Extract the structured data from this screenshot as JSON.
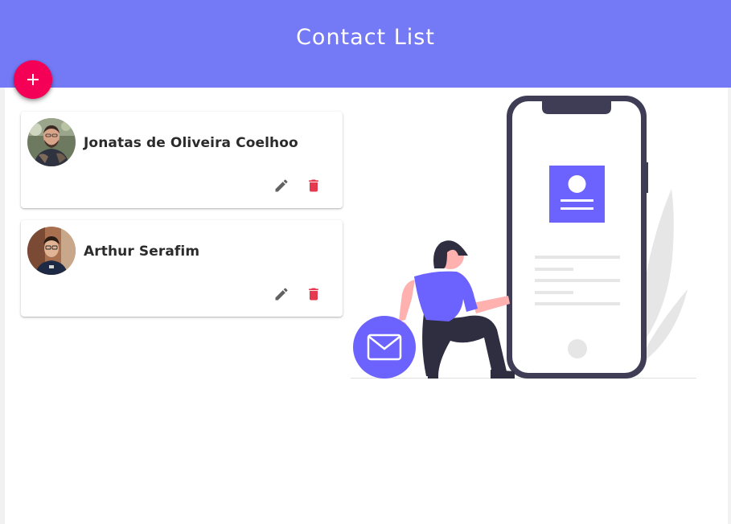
{
  "header": {
    "title": "Contact List"
  },
  "fab": {
    "icon": "plus-icon"
  },
  "contacts": [
    {
      "name": "Jonatas de Oliveira Coelhoo",
      "edit_icon": "pencil-icon",
      "delete_icon": "trash-icon"
    },
    {
      "name": "Arthur Serafim",
      "edit_icon": "pencil-icon",
      "delete_icon": "trash-icon"
    }
  ],
  "colors": {
    "header": "#7479f5",
    "fab": "#f50057",
    "delete": "#e53950",
    "edit": "#616161",
    "accent": "#6c63ff",
    "phone_frame": "#3f3d56"
  }
}
